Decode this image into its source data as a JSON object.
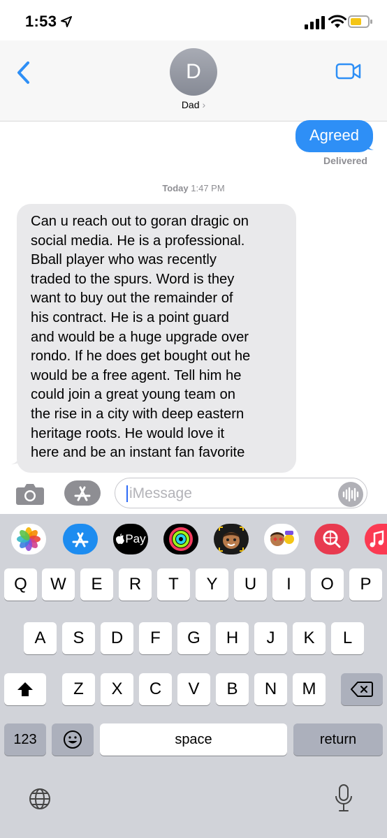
{
  "status_bar": {
    "time": "1:53",
    "icons": [
      "location-arrow-icon",
      "signal-bars-icon",
      "wifi-icon",
      "battery-icon"
    ]
  },
  "header": {
    "avatar_letter": "D",
    "contact_name": "Dad",
    "contact_chevron": "›",
    "icons": [
      "chevron-left-icon",
      "video-camera-icon"
    ]
  },
  "conversation": {
    "outgoing": {
      "text": "Agreed",
      "status": "Delivered"
    },
    "timestamp": {
      "day": "Today",
      "time": "1:47 PM"
    },
    "incoming": {
      "lines": [
        "Can u reach out to goran dragic on",
        "social media. He is a professional.",
        "Bball player who was recently",
        "traded to the spurs. Word is they",
        "want to buy out the remainder of",
        "his contract. He is a point guard",
        "and would be a huge upgrade over",
        "rondo. If he does get bought out he",
        "would be a free agent.  Tell him he",
        "could join a great young team on",
        "the rise in a city with deep eastern",
        "heritage roots. He would love it",
        "here and be an instant fan favorite"
      ]
    },
    "colors": {
      "outgoing_bubble": "#2e8ff6",
      "incoming_bubble": "#e9e9eb"
    }
  },
  "compose": {
    "placeholder": "iMessage",
    "icons": [
      "camera-icon",
      "app-store-icon",
      "audio-waveform-icon"
    ]
  },
  "app_strip": {
    "apple_pay_label": "Pay",
    "icons": [
      "photos-icon",
      "app-store-icon",
      "apple-pay-icon",
      "activity-rings-icon",
      "memoji-icon",
      "memoji-stickers-icon",
      "search-images-icon",
      "music-icon"
    ]
  },
  "keyboard": {
    "row1": [
      "Q",
      "W",
      "E",
      "R",
      "T",
      "Y",
      "U",
      "I",
      "O",
      "P"
    ],
    "row2": [
      "A",
      "S",
      "D",
      "F",
      "G",
      "H",
      "J",
      "K",
      "L"
    ],
    "row3": [
      "Z",
      "X",
      "C",
      "V",
      "B",
      "N",
      "M"
    ],
    "numbers_label": "123",
    "space_label": "space",
    "return_label": "return",
    "icons": [
      "shift-icon",
      "backspace-icon",
      "emoji-icon",
      "globe-icon",
      "microphone-icon"
    ]
  }
}
